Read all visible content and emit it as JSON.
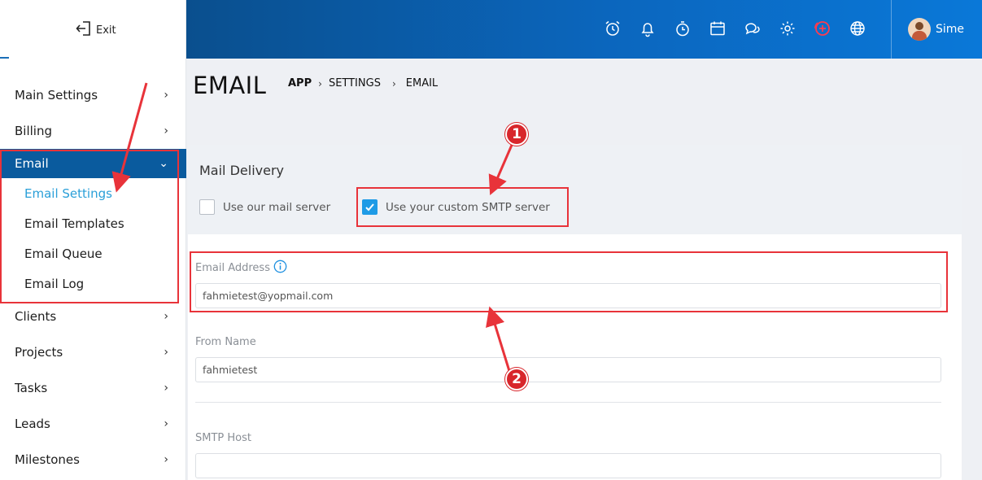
{
  "sidebar": {
    "exit_label": "Exit",
    "items": [
      {
        "label": "Main Settings",
        "chev": "›"
      },
      {
        "label": "Billing",
        "chev": "›"
      },
      {
        "label": "Email",
        "chev": "⌄"
      },
      {
        "label": "Clients",
        "chev": "›"
      },
      {
        "label": "Projects",
        "chev": "›"
      },
      {
        "label": "Tasks",
        "chev": "›"
      },
      {
        "label": "Leads",
        "chev": "›"
      },
      {
        "label": "Milestones",
        "chev": "›"
      }
    ],
    "email_submenu": [
      {
        "label": "Email Settings"
      },
      {
        "label": "Email Templates"
      },
      {
        "label": "Email Queue"
      },
      {
        "label": "Email Log"
      }
    ]
  },
  "header": {
    "icons": [
      "alarm-icon",
      "bell-icon",
      "timer-icon",
      "calendar-icon",
      "chat-icon",
      "gear-icon",
      "add-circle-icon",
      "globe-icon"
    ],
    "user_name": "Sime"
  },
  "page": {
    "title": "EMAIL",
    "breadcrumb": [
      "APP",
      "SETTINGS",
      "EMAIL"
    ],
    "breadcrumb_sep": "›"
  },
  "mail_delivery": {
    "title": "Mail Delivery",
    "option_ours": "Use our mail server",
    "option_custom": "Use your custom SMTP server"
  },
  "form": {
    "email_address_label": "Email Address",
    "email_address_value": "fahmietest@yopmail.com",
    "from_name_label": "From Name",
    "from_name_value": "fahmietest",
    "smtp_host_label": "SMTP Host",
    "smtp_host_value": ""
  },
  "annotations": {
    "badge_1": "1",
    "badge_2": "2",
    "color": "#e8333a"
  },
  "colors": {
    "sidebar_active": "#0a5b9e",
    "submenu_current": "#2a9fd8",
    "checkbox_checked": "#1e9be6"
  }
}
